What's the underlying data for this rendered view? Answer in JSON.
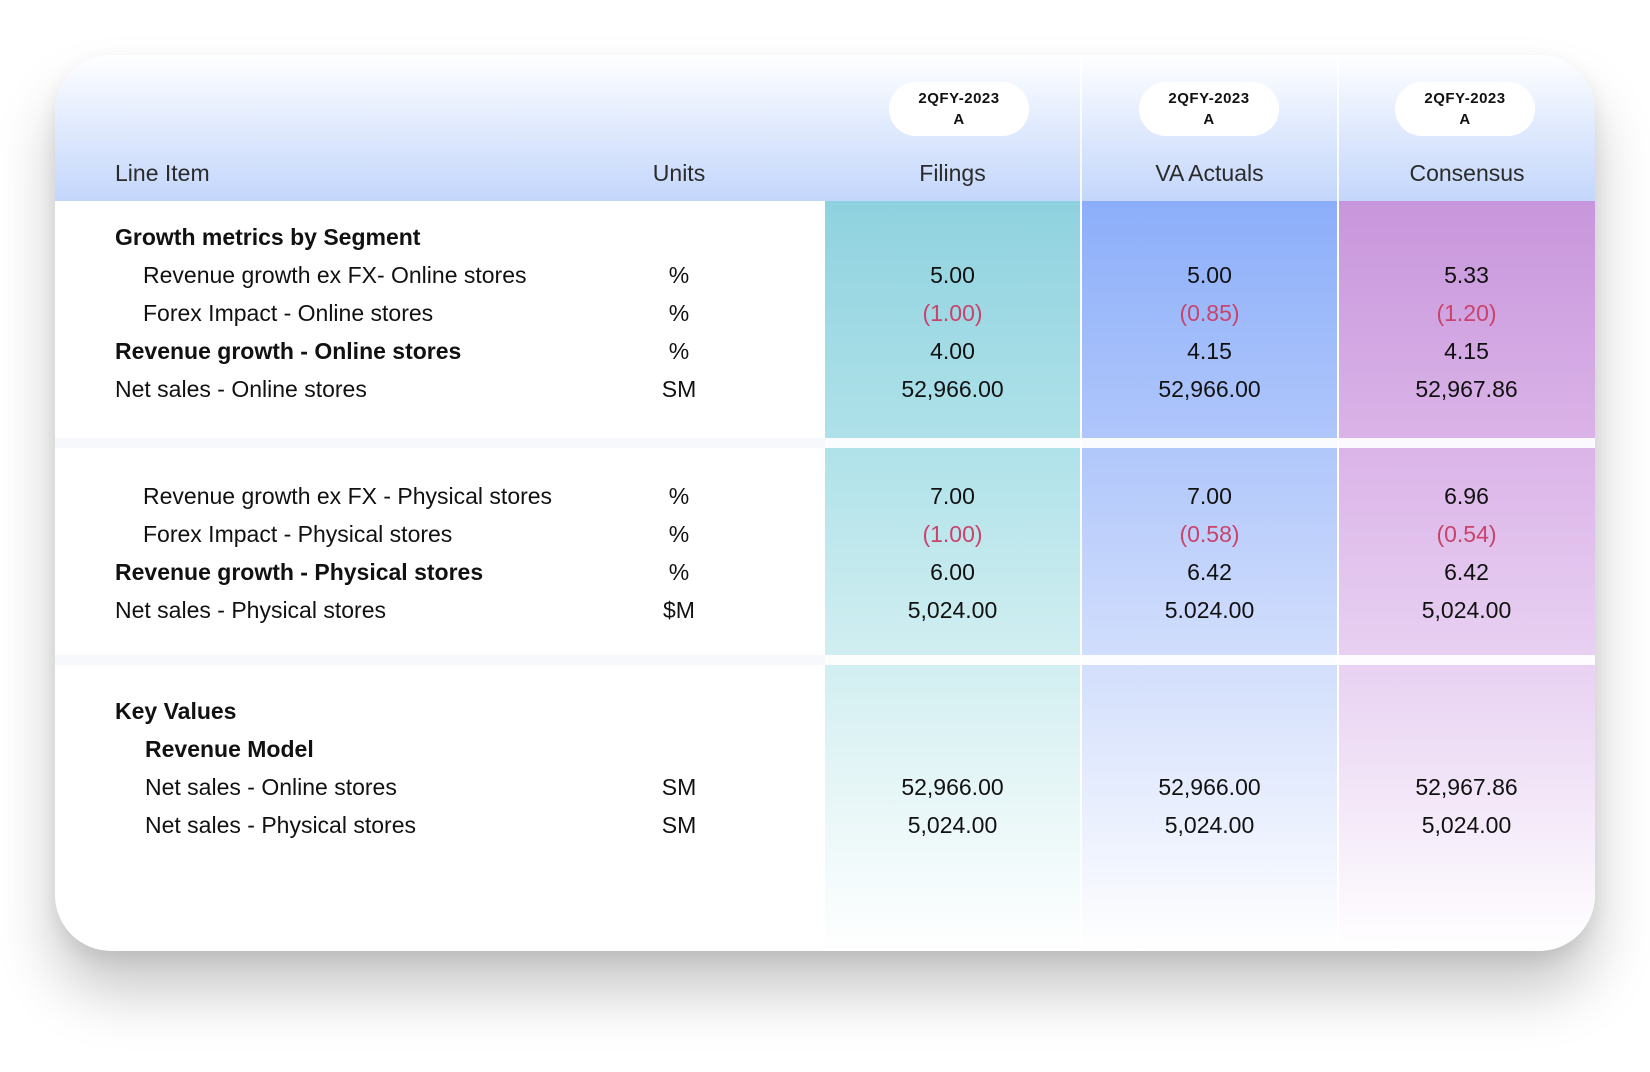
{
  "header": {
    "line_item": "Line Item",
    "units": "Units",
    "columns": [
      {
        "label": "Filings",
        "period": "2QFY-2023",
        "status": "A"
      },
      {
        "label": "VA Actuals",
        "period": "2QFY-2023",
        "status": "A"
      },
      {
        "label": "Consensus",
        "period": "2QFY-2023",
        "status": "A"
      }
    ]
  },
  "section1": {
    "title": "Growth metrics by Segment",
    "rows": [
      {
        "label": "Revenue growth ex FX- Online stores",
        "unit": "%",
        "filings": "5.00",
        "actuals": "5.00",
        "consensus": "5.33"
      },
      {
        "label": "Forex Impact - Online stores",
        "unit": "%",
        "filings": "(1.00)",
        "actuals": "(0.85)",
        "consensus": "(1.20)"
      },
      {
        "label": "Revenue growth - Online stores",
        "unit": "%",
        "filings": "4.00",
        "actuals": "4.15",
        "consensus": "4.15"
      },
      {
        "label": "Net sales - Online stores",
        "unit": "SM",
        "filings": "52,966.00",
        "actuals": "52,966.00",
        "consensus": "52,967.86"
      }
    ]
  },
  "section2": {
    "rows": [
      {
        "label": "Revenue growth ex FX - Physical stores",
        "unit": "%",
        "filings": "7.00",
        "actuals": "7.00",
        "consensus": "6.96"
      },
      {
        "label": "Forex Impact - Physical stores",
        "unit": "%",
        "filings": "(1.00)",
        "actuals": "(0.58)",
        "consensus": "(0.54)"
      },
      {
        "label": "Revenue growth - Physical stores",
        "unit": "%",
        "filings": "6.00",
        "actuals": "6.42",
        "consensus": "6.42"
      },
      {
        "label": "Net sales - Physical stores",
        "unit": "$M",
        "filings": "5,024.00",
        "actuals": "5.024.00",
        "consensus": "5,024.00"
      }
    ]
  },
  "section3": {
    "title": "Key Values",
    "subtitle": "Revenue Model",
    "rows": [
      {
        "label": "Net sales - Online stores",
        "unit": "SM",
        "filings": "52,966.00",
        "actuals": "52,966.00",
        "consensus": "52,967.86"
      },
      {
        "label": "Net sales - Physical stores",
        "unit": "SM",
        "filings": "5,024.00",
        "actuals": "5,024.00",
        "consensus": "5,024.00"
      }
    ]
  },
  "colors": {
    "negative": "#c9436a",
    "header": "#c3d6fb",
    "filings": "#8fd2df",
    "actuals": "#8caefa",
    "consensus": "#c896dc"
  }
}
